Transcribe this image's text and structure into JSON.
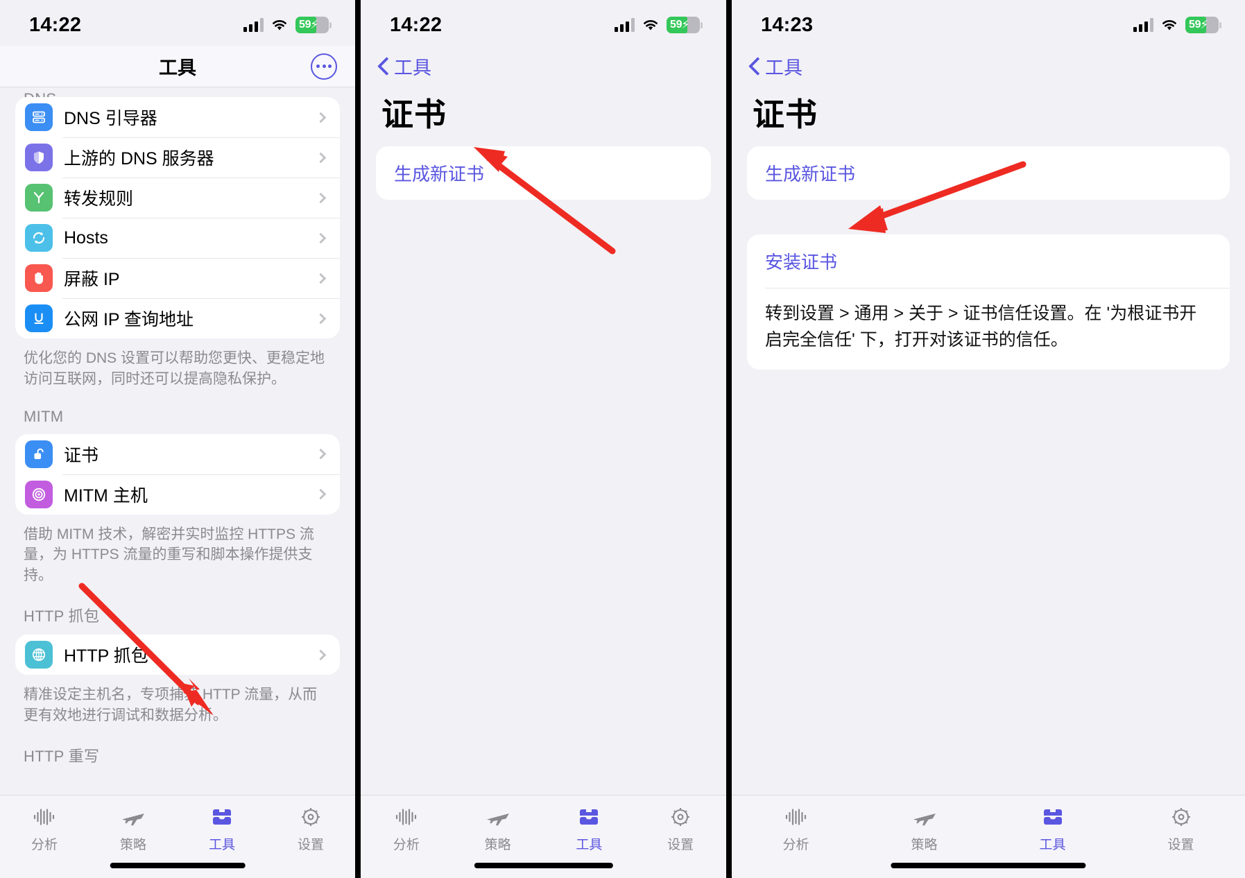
{
  "panel1": {
    "status": {
      "time": "14:22",
      "battery_percent": "59",
      "charging": true,
      "wifi": "wifi-icon",
      "cellular": "signal-icon"
    },
    "nav": {
      "title": "工具",
      "more_button": "more-icon"
    },
    "sections": [
      {
        "header": "DNS",
        "items": [
          {
            "label": "DNS 引导器",
            "icon": "server-icon",
            "color": "#3b8ef3"
          },
          {
            "label": "上游的 DNS 服务器",
            "icon": "shield-icon",
            "color": "#7b72e8"
          },
          {
            "label": "转发规则",
            "icon": "branch-icon",
            "color": "#56c272"
          },
          {
            "label": "Hosts",
            "icon": "refresh-icon",
            "color": "#4cc0e8"
          },
          {
            "label": "屏蔽 IP",
            "icon": "hand-icon",
            "color": "#f8584f"
          },
          {
            "label": "公网 IP 查询地址",
            "icon": "underline-u-icon",
            "color": "#1b8ef5"
          }
        ],
        "footnote": "优化您的 DNS 设置可以帮助您更快、更稳定地访问互联网，同时还可以提高隐私保护。"
      },
      {
        "header": "MITM",
        "items": [
          {
            "label": "证书",
            "icon": "unlock-icon",
            "color": "#3b8ef3"
          },
          {
            "label": "MITM 主机",
            "icon": "target-icon",
            "color": "#c25de0"
          }
        ],
        "footnote": "借助 MITM 技术，解密并实时监控 HTTPS 流量，为 HTTPS 流量的重写和脚本操作提供支持。"
      },
      {
        "header": "HTTP 抓包",
        "items": [
          {
            "label": "HTTP 抓包",
            "icon": "globe-icon",
            "color": "#4cc0d4"
          }
        ],
        "footnote": "精准设定主机名，专项捕获 HTTP 流量，从而更有效地进行调试和数据分析。"
      },
      {
        "header": "HTTP 重写",
        "items": [],
        "footnote": ""
      }
    ],
    "tabs": [
      {
        "label": "分析",
        "icon": "waveform-icon",
        "active": false
      },
      {
        "label": "策略",
        "icon": "airplane-icon",
        "active": false
      },
      {
        "label": "工具",
        "icon": "toolbox-icon",
        "active": true
      },
      {
        "label": "设置",
        "icon": "gear-icon",
        "active": false
      }
    ]
  },
  "panel2": {
    "status": {
      "time": "14:22",
      "battery_percent": "59",
      "charging": true,
      "wifi": "wifi-icon",
      "cellular": "signal-icon"
    },
    "nav": {
      "back_label": "工具",
      "back_icon": "chevron-left-icon"
    },
    "title": "证书",
    "actions": [
      {
        "label": "生成新证书"
      }
    ],
    "tabs": [
      {
        "label": "分析",
        "icon": "waveform-icon",
        "active": false
      },
      {
        "label": "策略",
        "icon": "airplane-icon",
        "active": false
      },
      {
        "label": "工具",
        "icon": "toolbox-icon",
        "active": true
      },
      {
        "label": "设置",
        "icon": "gear-icon",
        "active": false
      }
    ]
  },
  "panel3": {
    "status": {
      "time": "14:23",
      "battery_percent": "59",
      "charging": true,
      "wifi": "wifi-icon",
      "cellular": "signal-icon"
    },
    "nav": {
      "back_label": "工具",
      "back_icon": "chevron-left-icon"
    },
    "title": "证书",
    "generate_action": "生成新证书",
    "install_action": "安装证书",
    "install_help": "转到设置 > 通用 > 关于 > 证书信任设置。在 '为根证书开启完全信任' 下，打开对该证书的信任。",
    "tabs": [
      {
        "label": "分析",
        "icon": "waveform-icon",
        "active": false
      },
      {
        "label": "策略",
        "icon": "airplane-icon",
        "active": false
      },
      {
        "label": "工具",
        "icon": "toolbox-icon",
        "active": true
      },
      {
        "label": "设置",
        "icon": "gear-icon",
        "active": false
      }
    ]
  },
  "annotations": {
    "color": "#ee2b23",
    "arrows": [
      {
        "name": "arrow-to-tools-tab",
        "panel": 1
      },
      {
        "name": "arrow-to-generate-cert",
        "panel": 2
      },
      {
        "name": "arrow-to-install-cert",
        "panel": 3
      }
    ]
  }
}
